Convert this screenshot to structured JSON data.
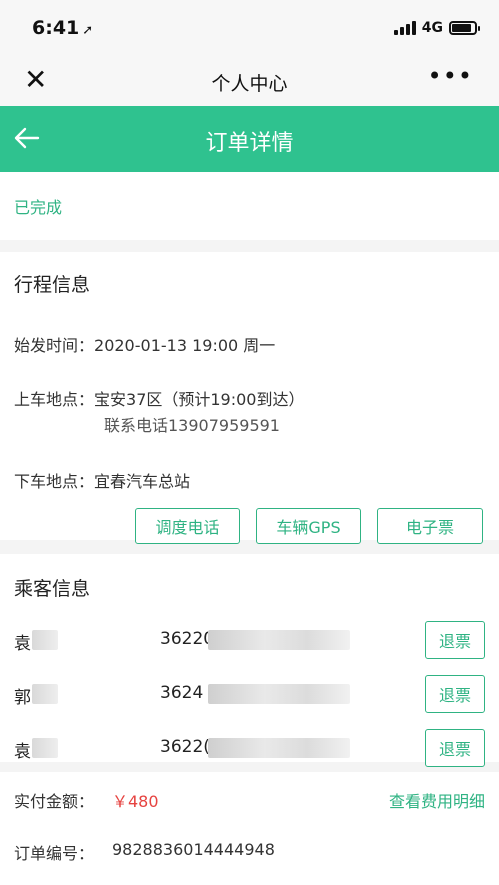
{
  "status_bar": {
    "time": "6:41",
    "location_glyph": "➚",
    "network": "4G",
    "battery_level": 0.85
  },
  "wechat_bar": {
    "close_glyph": "✕",
    "title": "个人中心",
    "more_glyph": "•••"
  },
  "header": {
    "title": "订单详情"
  },
  "order_status": "已完成",
  "trip": {
    "title": "行程信息",
    "depart_label": "始发时间：",
    "depart_value": "2020-01-13 19:00 周一",
    "pickup_label": "上车地点：",
    "pickup_value": "宝安37区（预计19:00到达）",
    "pickup_phone": "联系电话13907959591",
    "dropoff_label": "下车地点：",
    "dropoff_value": "宜春汽车总站",
    "buttons": [
      "调度电话",
      "车辆GPS",
      "电子票"
    ]
  },
  "passengers": {
    "title": "乘客信息",
    "refund_label": "退票",
    "items": [
      {
        "name": "袁",
        "id": "36220"
      },
      {
        "name": "郭",
        "id": "3624"
      },
      {
        "name": "袁",
        "id": "3622("
      }
    ]
  },
  "payment": {
    "paid_label": "实付金额：",
    "paid_amount": "￥480",
    "detail_link": "查看费用明细",
    "order_no_label": "订单编号：",
    "order_no": "9828836014444948"
  },
  "colors": {
    "brand_green": "#2fc28f",
    "accent_green": "#2fb383",
    "price_red": "#e64340"
  }
}
